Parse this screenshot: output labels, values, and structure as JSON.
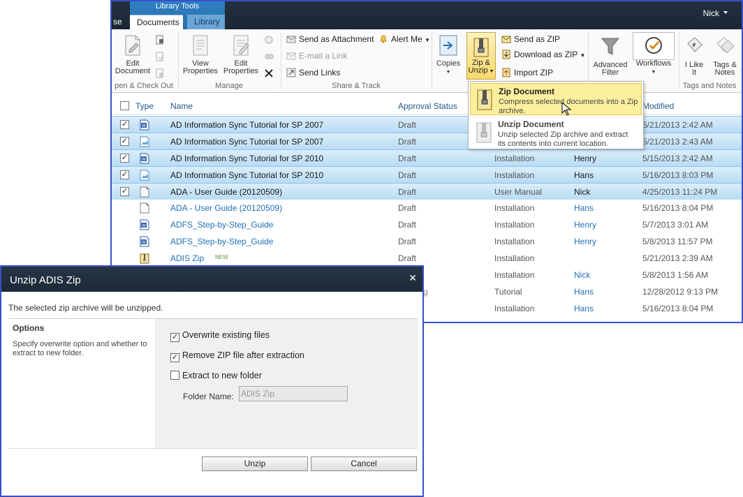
{
  "ribbon": {
    "partial_tab": "se",
    "context_group": "Library Tools",
    "tabs": [
      "Documents",
      "Library"
    ],
    "user": "Nick",
    "buttons": {
      "edit_document": [
        "Edit",
        "Document"
      ],
      "view_properties": [
        "View",
        "Properties"
      ],
      "edit_properties": [
        "Edit",
        "Properties"
      ],
      "send_as_attachment": "Send as Attachment",
      "email_link": "E-mail a Link",
      "send_links": "Send Links",
      "alert_me": "Alert Me",
      "copies": "Copies",
      "zip_unzip": [
        "Zip &",
        "Unzip"
      ],
      "send_as_zip": "Send as ZIP",
      "download_as_zip": "Download as ZIP",
      "import_zip": "Import ZIP",
      "advanced_filter": [
        "Advanced",
        "Filter"
      ],
      "workflows": "Workflows",
      "i_like_it": [
        "I Like",
        "It"
      ],
      "tags_notes": [
        "Tags &",
        "Notes"
      ]
    },
    "groups": {
      "open_checkout": "pen & Check Out",
      "manage": "Manage",
      "share_track": "Share & Track",
      "tags_notes": "Tags and Notes"
    }
  },
  "list": {
    "headers": {
      "type": "Type",
      "name": "Name",
      "approval": "Approval Status",
      "modified": "Modified"
    },
    "rows": [
      {
        "name": "AD Information Sync Tutorial for SP 2007",
        "approval": "Draft",
        "category": "",
        "by": "",
        "modified": "5/21/2013 2:42 AM",
        "selected": true,
        "type": "word"
      },
      {
        "name": "AD Information Sync Tutorial for SP 2007",
        "approval": "Draft",
        "category": "",
        "by": "",
        "modified": "5/21/2013 2:43 AM",
        "selected": true,
        "type": "image"
      },
      {
        "name": "AD Information Sync Tutorial for SP 2010",
        "approval": "Draft",
        "category": "Installation",
        "by": "Henry",
        "modified": "5/15/2013 2:42 AM",
        "selected": true,
        "type": "word"
      },
      {
        "name": "AD Information Sync Tutorial for SP 2010",
        "approval": "Draft",
        "category": "Installation",
        "by": "Hans",
        "modified": "5/16/2013 8:03 PM",
        "selected": true,
        "type": "image"
      },
      {
        "name": "ADA - User Guide (20120509)",
        "approval": "Draft",
        "category": "User Manual",
        "by": "Nick",
        "modified": "4/25/2013 11:24 PM",
        "selected": true,
        "type": "blank"
      },
      {
        "name": "ADA - User Guide (20120509)",
        "approval": "Draft",
        "category": "Installation",
        "by": "Hans",
        "modified": "5/16/2013 8:04 PM",
        "selected": false,
        "type": "blank"
      },
      {
        "name": "ADFS_Step-by-Step_Guide",
        "approval": "Draft",
        "category": "Installation",
        "by": "Henry",
        "modified": "5/7/2013 3:01 AM",
        "selected": false,
        "type": "word"
      },
      {
        "name": "ADFS_Step-by-Step_Guide",
        "approval": "Draft",
        "category": "Installation",
        "by": "Henry",
        "modified": "5/8/2013 11:57 PM",
        "selected": false,
        "type": "word"
      },
      {
        "name": "ADIS Zip",
        "approval": "Draft",
        "category": "Installation",
        "by": "",
        "modified": "5/21/2013 2:39 AM",
        "selected": false,
        "type": "zip",
        "new": "NEW"
      },
      {
        "name": "",
        "approval": "",
        "category": "Installation",
        "by": "Nick",
        "modified": "5/8/2013 1:56 AM",
        "selected": false,
        "type": "none"
      },
      {
        "name": "",
        "approval": "",
        "category": "Tutorial",
        "by": "Hans",
        "modified": "12/28/2012 9:13 PM",
        "selected": false,
        "type": "none",
        "fragment": "g"
      },
      {
        "name": "",
        "approval": "",
        "category": "Installation",
        "by": "Hans",
        "modified": "5/16/2013 8:04 PM",
        "selected": false,
        "type": "none"
      }
    ]
  },
  "dropdown": {
    "zip": {
      "title": "Zip Document",
      "desc": "Compress selected documents into a Zip archive."
    },
    "unzip": {
      "title": "Unzip Document",
      "desc": "Unzip selected Zip archive and extract its contents into current location."
    }
  },
  "dialog": {
    "title": "Unzip ADIS Zip",
    "message": "The selected zip archive will be unzipped.",
    "options_heading": "Options",
    "options_desc": "Specify overwrite option and whether to extract to new folder.",
    "overwrite": "Overwrite existing files",
    "remove_zip": "Remove ZIP file after extraction",
    "extract_new": "Extract to new folder",
    "folder_label": "Folder Name:",
    "folder_value": "ADIS Zip",
    "unzip_btn": "Unzip",
    "cancel_btn": "Cancel"
  }
}
